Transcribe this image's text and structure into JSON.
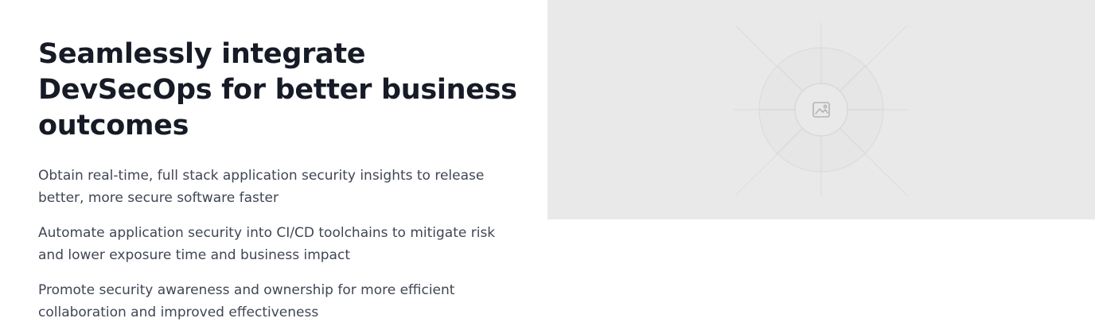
{
  "headline": "Seamlessly integrate DevSecOps for better business outcomes",
  "bullets": [
    "Obtain real-time, full stack application security insights to release better, more secure software faster",
    "Automate application security into CI/CD toolchains to mitigate risk and lower exposure time and business impact",
    "Promote security awareness and ownership for more efficient collaboration and improved effectiveness"
  ],
  "media": {
    "icon": "image-icon",
    "placeholder_color": "#e9e9e9"
  }
}
